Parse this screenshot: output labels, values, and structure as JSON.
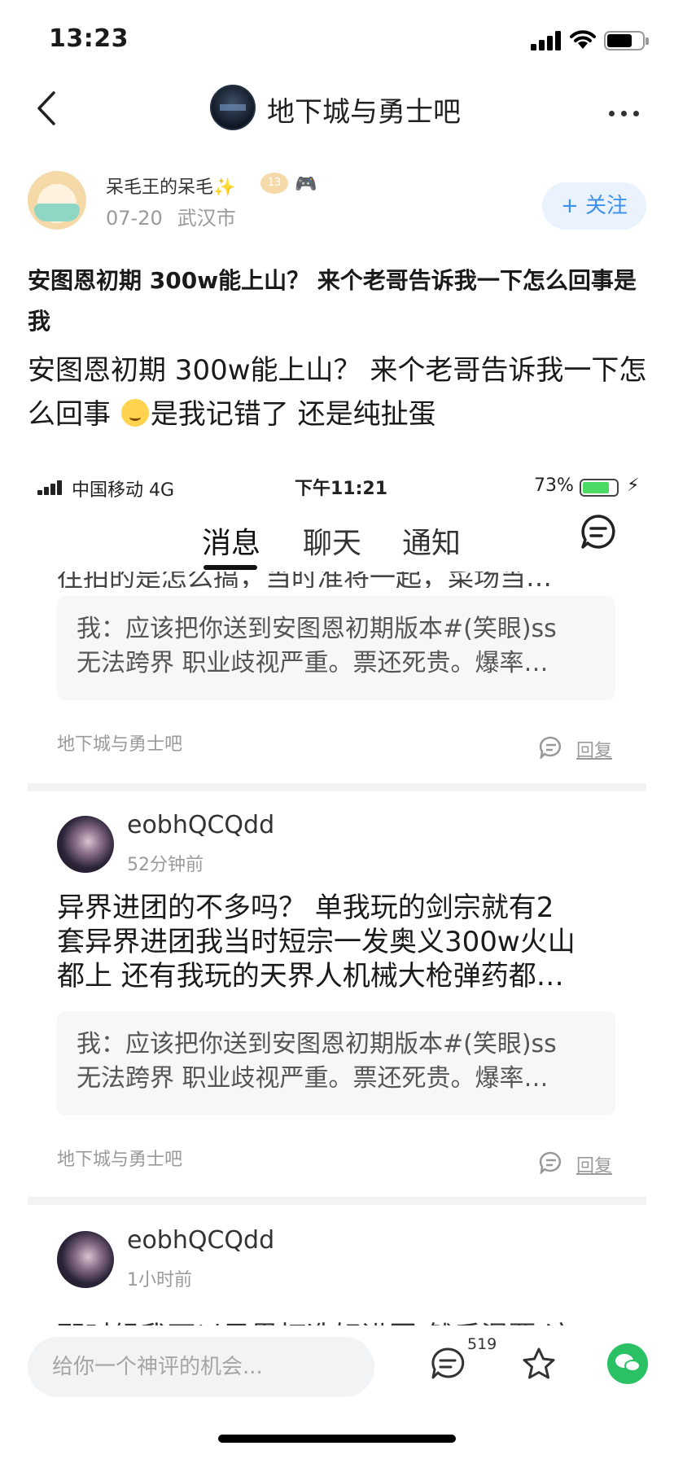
{
  "status_bar": {
    "time": "13:23"
  },
  "nav": {
    "forum_title": "地下城与勇士吧"
  },
  "author": {
    "name": "呆毛王的呆毛✨",
    "level": "13",
    "date": "07-20",
    "location": "武汉市",
    "follow_label": "+ 关注"
  },
  "post": {
    "title": "安图恩初期 300w能上山？ 来个老哥告诉我一下怎么回事是我",
    "body_1": "安图恩初期 300w能上山？ 来个老哥告诉我一下怎么回事",
    "body_2": "是我记错了 还是纯扯蛋"
  },
  "screenshot": {
    "carrier": "中国移动   4G",
    "time": "下午11:21",
    "battery": "73%",
    "tabs": [
      "消息",
      "聊天",
      "通知"
    ],
    "cut_text": "往拍的是怎么搞，当时准将一起，菜场当…",
    "quote_1": "我：应该把你送到安图恩初期版本#(笑眼)ss",
    "quote_2": "无法跨界 职业歧视严重。票还死贵。爆率…",
    "forum_label": "地下城与勇士吧",
    "reply_label": "回复",
    "comments": [
      {
        "user": "eobhQCQdd",
        "time": "52分钟前",
        "lines": [
          "异界进团的不多吗？  单我玩的剑宗就有2",
          "套异界进团我当时短宗一发奥义300w火山",
          "都上 还有我玩的天界人机械大枪弹药都…"
        ]
      },
      {
        "user": "eobhQCQdd",
        "time": "1小时前",
        "cut_line": "那时候我可以异界打造好进团 然后混票 这"
      }
    ]
  },
  "bottom_bar": {
    "placeholder": "给你一个神评的机会...",
    "comment_count": "519"
  }
}
